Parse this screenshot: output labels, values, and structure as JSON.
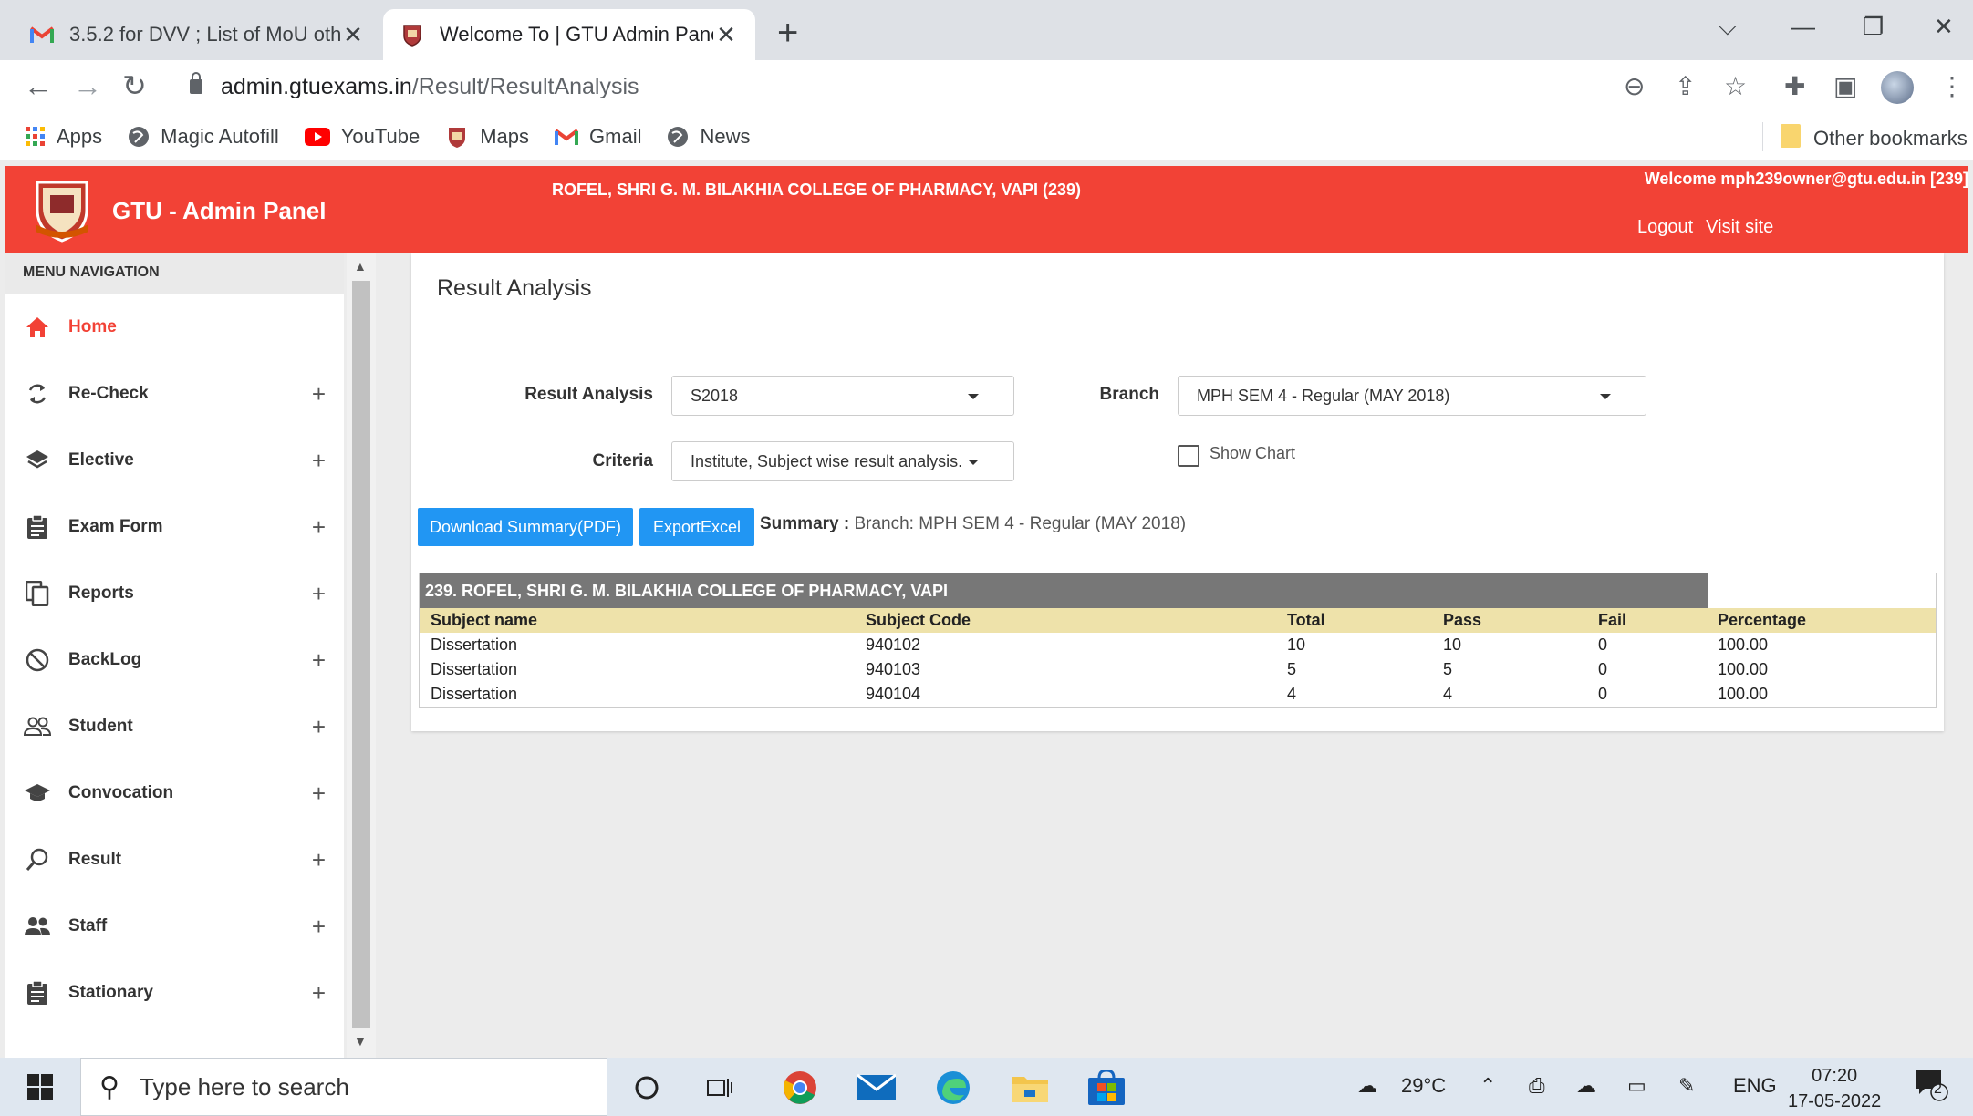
{
  "browser": {
    "tabs": [
      {
        "title": "3.5.2 for DVV ; List of MoU other",
        "active": false
      },
      {
        "title": "Welcome To | GTU Admin Panel",
        "active": true
      }
    ],
    "url_host": "admin.gtuexams.in",
    "url_path": "/Result/ResultAnalysis",
    "bookmarks": [
      {
        "label": "Apps",
        "icon": "apps-grid-icon"
      },
      {
        "label": "Magic Autofill",
        "icon": "globe-icon"
      },
      {
        "label": "YouTube",
        "icon": "youtube-icon"
      },
      {
        "label": "Maps",
        "icon": "gtu-crest-icon"
      },
      {
        "label": "Gmail",
        "icon": "gmail-icon"
      },
      {
        "label": "News",
        "icon": "globe-icon"
      }
    ],
    "other_bookmarks": "Other bookmarks"
  },
  "header": {
    "brand": "GTU - Admin Panel",
    "college": "ROFEL, SHRI G. M. BILAKHIA COLLEGE OF PHARMACY, VAPI (239)",
    "welcome": "Welcome mph239owner@gtu.edu.in [239]",
    "logout": "Logout",
    "visit_site": "Visit site"
  },
  "sidebar": {
    "heading": "MENU NAVIGATION",
    "items": [
      {
        "label": "Home",
        "icon": "home-icon"
      },
      {
        "label": "Re-Check",
        "icon": "refresh-icon"
      },
      {
        "label": "Elective",
        "icon": "layers-icon"
      },
      {
        "label": "Exam Form",
        "icon": "clipboard-icon"
      },
      {
        "label": "Reports",
        "icon": "copy-icon"
      },
      {
        "label": "BackLog",
        "icon": "block-icon"
      },
      {
        "label": "Student",
        "icon": "people-icon"
      },
      {
        "label": "Convocation",
        "icon": "graduation-cap-icon"
      },
      {
        "label": "Result",
        "icon": "search-icon"
      },
      {
        "label": "Staff",
        "icon": "group-icon"
      },
      {
        "label": "Stationary",
        "icon": "clipboard-icon"
      }
    ]
  },
  "main": {
    "title": "Result Analysis",
    "result_analysis_label": "Result Analysis",
    "result_analysis_value": "S2018",
    "branch_label": "Branch",
    "branch_value": "MPH SEM 4 - Regular (MAY 2018)",
    "criteria_label": "Criteria",
    "criteria_value": "Institute, Subject wise result analysis.",
    "show_chart_label": "Show Chart",
    "download_btn": "Download Summary(PDF)",
    "export_btn": "ExportExcel",
    "summary_label": "Summary :",
    "summary_text": "Branch: MPH SEM 4 - Regular (MAY 2018)",
    "table": {
      "caption": "239. ROFEL, SHRI G. M. BILAKHIA COLLEGE OF PHARMACY, VAPI",
      "headers": [
        "Subject name",
        "Subject Code",
        "Total",
        "Pass",
        "Fail",
        "Percentage"
      ],
      "rows": [
        [
          "Dissertation",
          "940102",
          "10",
          "10",
          "0",
          "100.00"
        ],
        [
          "Dissertation",
          "940103",
          "5",
          "5",
          "0",
          "100.00"
        ],
        [
          "Dissertation",
          "940104",
          "4",
          "4",
          "0",
          "100.00"
        ]
      ]
    }
  },
  "taskbar": {
    "search_placeholder": "Type here to search",
    "temperature": "29°C",
    "language": "ENG",
    "time": "07:20",
    "date": "17-05-2022",
    "notifications": "2"
  }
}
